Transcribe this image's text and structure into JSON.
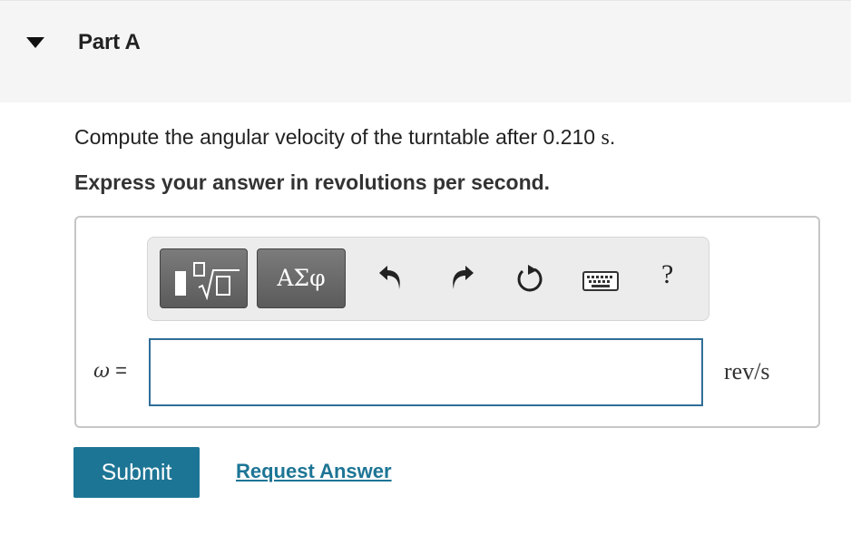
{
  "part": {
    "title": "Part A"
  },
  "question": {
    "prompt": "Compute the angular velocity of the turntable after 0.210",
    "prompt_unit": "s",
    "prompt_end": ".",
    "instruction": "Express your answer in revolutions per second."
  },
  "toolbar": {
    "greek_label": "ΑΣφ",
    "help_label": "?",
    "icons": [
      "templates-icon",
      "undo-icon",
      "redo-icon",
      "reset-icon",
      "keyboard-icon",
      "help-icon"
    ]
  },
  "answer": {
    "variable": "ω",
    "equals": "=",
    "value": "",
    "unit": "rev/s"
  },
  "actions": {
    "submit_label": "Submit",
    "request_label": "Request Answer"
  },
  "colors": {
    "accent": "#1d7595",
    "input_border": "#2f6e98",
    "header_bg": "#f5f5f5"
  }
}
